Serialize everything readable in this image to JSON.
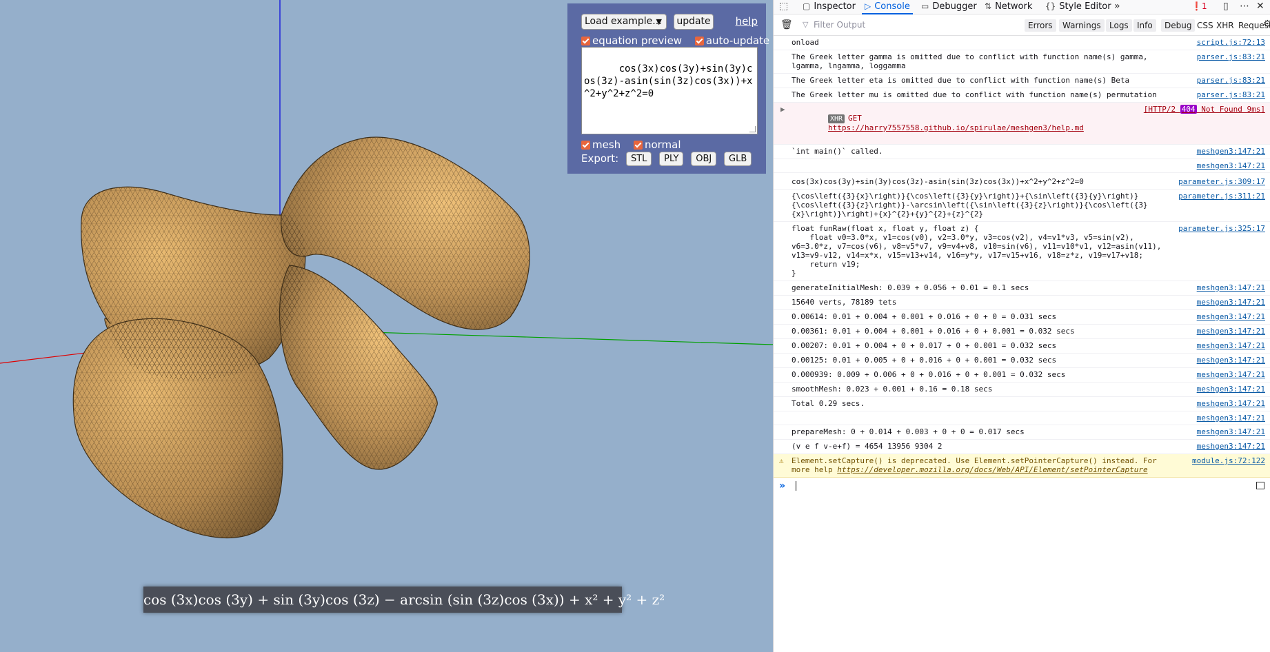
{
  "panel": {
    "load_example": "Load example...",
    "update": "update",
    "help": "help",
    "equation_preview": "equation preview",
    "auto_update": "auto-update",
    "equation": "cos(3x)cos(3y)+sin(3y)cos(3z)-asin(sin(3z)cos(3x))+x^2+y^2+z^2=0",
    "mesh": "mesh",
    "normal": "normal",
    "export_label": "Export:",
    "export_buttons": [
      "STL",
      "PLY",
      "OBJ",
      "GLB"
    ]
  },
  "preview": {
    "latex_text": "cos (3x)cos (3y) + sin (3y)cos (3z) − arcsin (sin (3z)cos (3x)) + x² + y² + z²"
  },
  "devtools": {
    "tabs": [
      "Inspector",
      "Console",
      "Debugger",
      "Network",
      "Style Editor"
    ],
    "active_tab": "Console",
    "error_count": "1",
    "filter_placeholder": "Filter Output",
    "filter_buttons": [
      "Errors",
      "Warnings",
      "Logs",
      "Info",
      "Debug"
    ],
    "extra_filters": [
      "CSS",
      "XHR",
      "Requests"
    ],
    "messages": [
      {
        "text": "onload",
        "src": "script.js:72:13"
      },
      {
        "text": "The Greek letter gamma is omitted due to conflict with function name(s) gamma, lgamma, lngamma, loggamma",
        "src": "parser.js:83:21"
      },
      {
        "text": "The Greek letter eta is omitted due to conflict with function name(s) Beta",
        "src": "parser.js:83:21"
      },
      {
        "text": "The Greek letter mu is omitted due to conflict with function name(s) permutation",
        "src": "parser.js:83:21"
      },
      {
        "text": "`int main()` called.",
        "src": "meshgen3:147:21"
      },
      {
        "text": "",
        "src": "meshgen3:147:21"
      },
      {
        "text": "cos(3x)cos(3y)+sin(3y)cos(3z)-asin(sin(3z)cos(3x))+x^2+y^2+z^2=0",
        "src": "parameter.js:309:17"
      },
      {
        "text": "{\\cos\\left({3}{x}\\right)}{\\cos\\left({3}{y}\\right)}+{\\sin\\left({3}{y}\\right)}{\\cos\\left({3}{z}\\right)}-\\arcsin\\left({\\sin\\left({3}{z}\\right)}{\\cos\\left({3}{x}\\right)}\\right)+{x}^{2}+{y}^{2}+{z}^{2}",
        "src": "parameter.js:311:21"
      },
      {
        "text": "float funRaw(float x, float y, float z) {\n    float v0=3.0*x, v1=cos(v0), v2=3.0*y, v3=cos(v2), v4=v1*v3, v5=sin(v2), v6=3.0*z, v7=cos(v6), v8=v5*v7, v9=v4+v8, v10=sin(v6), v11=v10*v1, v12=asin(v11), v13=v9-v12, v14=x*x, v15=v13+v14, v16=y*y, v17=v15+v16, v18=z*z, v19=v17+v18;\n    return v19;\n}",
        "src": "parameter.js:325:17"
      },
      {
        "text": "generateInitialMesh: 0.039 + 0.056 + 0.01 = 0.1 secs",
        "src": "meshgen3:147:21"
      },
      {
        "text": "15640 verts, 78189 tets",
        "src": "meshgen3:147:21"
      },
      {
        "text": "0.00614: 0.01 + 0.004 + 0.001 + 0.016 + 0 + 0 = 0.031 secs",
        "src": "meshgen3:147:21"
      },
      {
        "text": "0.00361: 0.01 + 0.004 + 0.001 + 0.016 + 0 + 0.001 = 0.032 secs",
        "src": "meshgen3:147:21"
      },
      {
        "text": "0.00207: 0.01 + 0.004 + 0 + 0.017 + 0 + 0.001 = 0.032 secs",
        "src": "meshgen3:147:21"
      },
      {
        "text": "0.00125: 0.01 + 0.005 + 0 + 0.016 + 0 + 0.001 = 0.032 secs",
        "src": "meshgen3:147:21"
      },
      {
        "text": "0.000939: 0.009 + 0.006 + 0 + 0.016 + 0 + 0.001 = 0.032 secs",
        "src": "meshgen3:147:21"
      },
      {
        "text": "smoothMesh: 0.023 + 0.001 + 0.16 = 0.18 secs",
        "src": "meshgen3:147:21"
      },
      {
        "text": "Total 0.29 secs.",
        "src": "meshgen3:147:21"
      },
      {
        "text": "",
        "src": "meshgen3:147:21"
      },
      {
        "text": "prepareMesh: 0 + 0.014 + 0.003 + 0 + 0 = 0.017 secs",
        "src": "meshgen3:147:21"
      },
      {
        "text": "(v e f v-e+f) = 4654 13956 9304 2",
        "src": "meshgen3:147:21"
      }
    ],
    "xhr_error": {
      "badge": "XHR",
      "method": "GET",
      "url": "https://harry7557558.github.io/spirulae/meshgen3/help.md",
      "status_prefix": "[HTTP/2 ",
      "status_code": "404",
      "status_suffix": " Not Found 9ms]"
    },
    "warning": {
      "text": "Element.setCapture() is deprecated. Use Element.setPointerCapture() instead. For more help",
      "link": "https://developer.mozilla.org/docs/Web/API/Element/setPointerCapture",
      "src": "module.js:72:122"
    }
  },
  "colors": {
    "viewport_bg": "#95afcb",
    "panel_bg": "#5b6aa4",
    "surface": "#c49a5e",
    "accent": "#0060df",
    "axis_x": "#e00000",
    "axis_y": "#00a000",
    "axis_z": "#0000e0"
  }
}
